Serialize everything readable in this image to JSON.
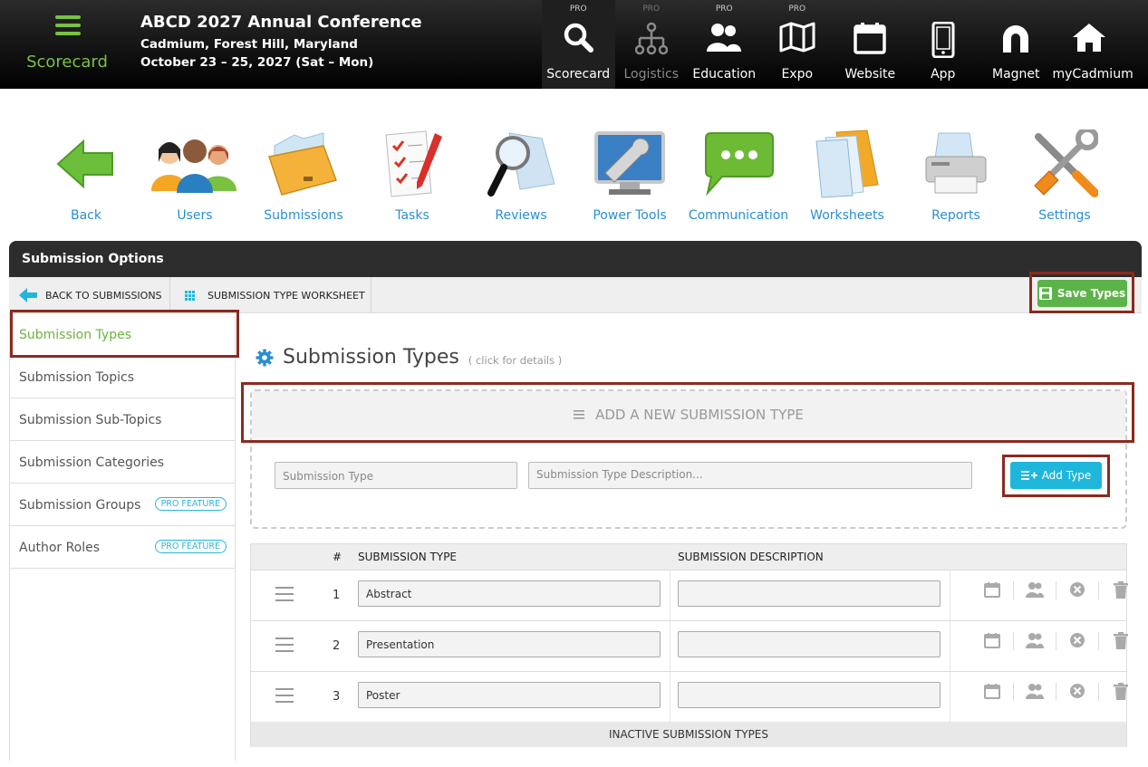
{
  "header": {
    "brand_label": "Scorecard",
    "conference_title": "ABCD 2027 Annual Conference",
    "location": "Cadmium, Forest Hill, Maryland",
    "dates": "October 23 – 25, 2027 (Sat – Mon)"
  },
  "topnav": [
    {
      "pro": "PRO",
      "label": "Scorecard",
      "icon": "search-icon"
    },
    {
      "pro": "PRO",
      "label": "Logistics",
      "icon": "hierarchy-icon"
    },
    {
      "pro": "PRO",
      "label": "Education",
      "icon": "people-icon"
    },
    {
      "pro": "PRO",
      "label": "Expo",
      "icon": "map-icon"
    },
    {
      "pro": "",
      "label": "Website",
      "icon": "calendar-icon"
    },
    {
      "pro": "",
      "label": "App",
      "icon": "phone-icon"
    },
    {
      "pro": "",
      "label": "Magnet",
      "icon": "magnet-icon"
    },
    {
      "pro": "",
      "label": "myCadmium",
      "icon": "home-icon"
    }
  ],
  "iconrow": [
    {
      "label": "Back",
      "icon": "back-arrow-icon"
    },
    {
      "label": "Users",
      "icon": "users-icon"
    },
    {
      "label": "Submissions",
      "icon": "folder-icon"
    },
    {
      "label": "Tasks",
      "icon": "checklist-icon"
    },
    {
      "label": "Reviews",
      "icon": "magnifier-icon"
    },
    {
      "label": "Power Tools",
      "icon": "monitor-wrench-icon"
    },
    {
      "label": "Communication",
      "icon": "chat-bubble-icon"
    },
    {
      "label": "Worksheets",
      "icon": "documents-icon"
    },
    {
      "label": "Reports",
      "icon": "printer-icon"
    },
    {
      "label": "Settings",
      "icon": "tools-icon"
    }
  ],
  "panel": {
    "title": "Submission Options",
    "back_label": "BACK TO SUBMISSIONS",
    "worksheet_label": "SUBMISSION TYPE WORKSHEET",
    "save_label": "Save Types"
  },
  "sidebar": {
    "items": [
      {
        "label": "Submission Types",
        "badge": ""
      },
      {
        "label": "Submission Topics",
        "badge": ""
      },
      {
        "label": "Submission Sub-Topics",
        "badge": ""
      },
      {
        "label": "Submission Categories",
        "badge": ""
      },
      {
        "label": "Submission Groups",
        "badge": "PRO FEATURE"
      },
      {
        "label": "Author Roles",
        "badge": "PRO FEATURE"
      }
    ]
  },
  "main": {
    "title": "Submission Types",
    "subtitle": "( click for details )",
    "add_header": "ADD A NEW SUBMISSION TYPE",
    "type_placeholder": "Submission Type",
    "desc_placeholder": "Submission Type Description...",
    "add_button": "Add Type"
  },
  "table": {
    "headers": {
      "num": "#",
      "type": "SUBMISSION TYPE",
      "desc": "SUBMISSION DESCRIPTION"
    },
    "rows": [
      {
        "num": "1",
        "type": "Abstract",
        "desc": ""
      },
      {
        "num": "2",
        "type": "Presentation",
        "desc": ""
      },
      {
        "num": "3",
        "type": "Poster",
        "desc": ""
      }
    ],
    "footer": "INACTIVE SUBMISSION TYPES"
  },
  "colors": {
    "accent_green": "#6cb33f",
    "link_blue": "#2a8fcf",
    "button_cyan": "#1fb6dc",
    "save_green": "#5cb349",
    "outline": "#8b2a1e"
  }
}
